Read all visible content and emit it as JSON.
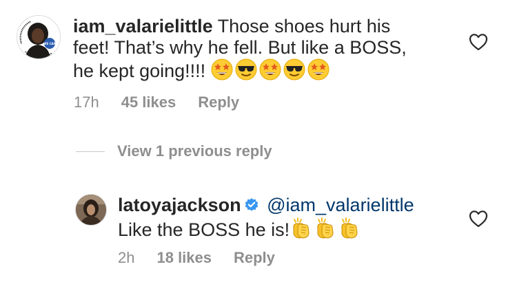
{
  "comments": [
    {
      "username": "iam_valarielittle",
      "text": "Those shoes hurt his feet! That’s why he fell. But like a BOSS, he kept going!!!!",
      "emojis": [
        "star-struck",
        "sunglasses",
        "star-struck",
        "sunglasses",
        "star-struck"
      ],
      "time": "17h",
      "likes": "45 likes",
      "reply_label": "Reply",
      "avatar_text": {
        "left": "I GOT MY COVID-19 VACCINE",
        "badge": "WE CAN DO THIS"
      }
    },
    {
      "username": "latoyajackson",
      "verified": true,
      "mention": "@iam_valarielittle",
      "text": "Like the BOSS he is!",
      "emojis": [
        "clapping-hands",
        "clapping-hands",
        "clapping-hands"
      ],
      "time": "2h",
      "likes": "18 likes",
      "reply_label": "Reply"
    }
  ],
  "view_replies_label": "View 1 previous reply",
  "colors": {
    "text": "#262626",
    "meta": "#8e8e8e",
    "mention": "#00376b",
    "verified": "#3897f0"
  }
}
